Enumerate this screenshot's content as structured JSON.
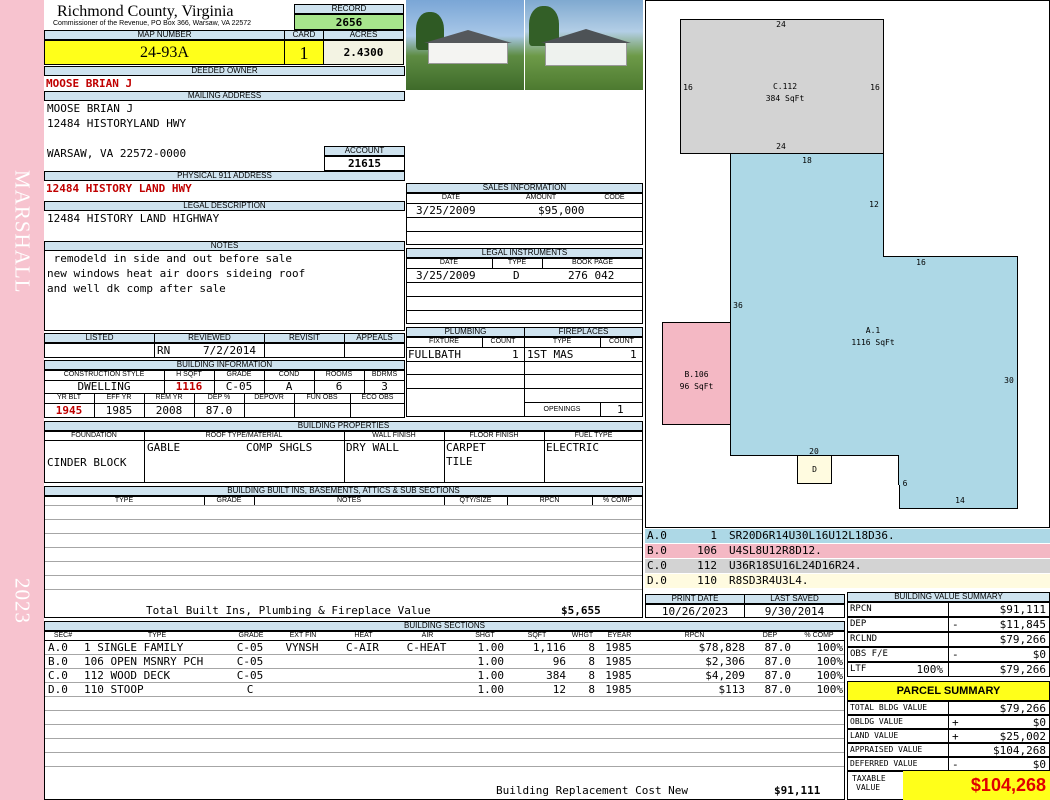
{
  "side": {
    "district": "MARSHALL",
    "year": "2023"
  },
  "header": {
    "county": "Richmond County, Virginia",
    "commissioner": "Commissioner of the Revenue, PO Box 366, Warsaw, VA 22572",
    "record_label": "RECORD",
    "record": "2656",
    "map_label": "MAP NUMBER",
    "map_number": "24-93A",
    "card_label": "CARD",
    "card": "1",
    "acres_label": "ACRES",
    "acres": "2.4300"
  },
  "owner": {
    "deeded_label": "DEEDED OWNER",
    "deeded": "MOOSE BRIAN J",
    "mailing_label": "MAILING ADDRESS",
    "mail_line1": "MOOSE BRIAN J",
    "mail_line2": "12484 HISTORYLAND HWY",
    "mail_line3": "WARSAW, VA 22572-0000",
    "account_label": "ACCOUNT",
    "account": "21615",
    "physical_label": "PHYSICAL 911 ADDRESS",
    "physical": "12484 HISTORY LAND HWY",
    "legal_label": "LEGAL DESCRIPTION",
    "legal": "12484 HISTORY LAND HIGHWAY",
    "notes_label": "NOTES",
    "note1": " remodeld in side and out before sale",
    "note2": "new windows heat air doors sideing roof",
    "note3": "and well dk comp after sale"
  },
  "listing": {
    "listed_label": "LISTED",
    "reviewed_label": "REVIEWED",
    "revisit_label": "REVISIT",
    "appeals_label": "APPEALS",
    "reviewer": "RN",
    "reviewed_date": "7/2/2014"
  },
  "building_info": {
    "title": "BUILDING INFORMATION",
    "h1": "CONSTRUCTION STYLE",
    "h2": "H SQFT",
    "h3": "GRADE",
    "h4": "COND",
    "h5": "ROOMS",
    "h6": "BDRMS",
    "style": "DWELLING",
    "hsqft": "1116",
    "grade": "C-05",
    "cond": "A",
    "rooms": "6",
    "bdrms": "3",
    "g1": "YR BLT",
    "g2": "EFF YR",
    "g3": "REM YR",
    "g4": "DEP %",
    "g5": "DEPOVR",
    "g6": "FUN OBS",
    "g7": "ECO OBS",
    "yrblt": "1945",
    "effyr": "1985",
    "remyr": "2008",
    "dep": "87.0"
  },
  "sales": {
    "title": "SALES INFORMATION",
    "date_h": "DATE",
    "amount_h": "AMOUNT",
    "code_h": "CODE",
    "date": "3/25/2009",
    "amount": "$95,000"
  },
  "legal_instruments": {
    "title": "LEGAL INSTRUMENTS",
    "date_h": "DATE",
    "type_h": "TYPE",
    "book_h": "BOOK PAGE",
    "date": "3/25/2009",
    "type": "D",
    "book": "276 042"
  },
  "plumbing": {
    "title": "PLUMBING",
    "fixture_h": "FIXTURE",
    "count_h": "COUNT",
    "fixture": "FULLBATH",
    "count": "1"
  },
  "fireplaces": {
    "title": "FIREPLACES",
    "type_h": "TYPE",
    "count_h": "COUNT",
    "type": "1ST MAS",
    "count": "1",
    "openings_label": "OPENINGS",
    "openings": "1"
  },
  "properties": {
    "title": "BUILDING PROPERTIES",
    "foundation_h": "FOUNDATION",
    "roof_h": "ROOF TYPE/MATERIAL",
    "wall_h": "WALL FINISH",
    "floor_h": "FLOOR FINISH",
    "fuel_h": "FUEL TYPE",
    "foundation": "CINDER BLOCK",
    "roof_type": "GABLE",
    "roof_material": "COMP SHGLS",
    "wall": "DRY WALL",
    "floor1": "CARPET",
    "floor2": "TILE",
    "fuel": "ELECTRIC"
  },
  "builtins": {
    "title": "BUILDING BUILT INS, BASEMENTS, ATTICS & SUB SECTIONS",
    "type_h": "TYPE",
    "grade_h": "GRADE",
    "notes_h": "NOTES",
    "qty_h": "QTY/SIZE",
    "rpcn_h": "RPCN",
    "comp_h": "% COMP",
    "total_label": "Total Built Ins, Plumbing & Fireplace Value",
    "total": "$5,655"
  },
  "sketch": {
    "labels": {
      "c_name": "C.112",
      "c_area": "384 SqFt",
      "a_name": "A.1",
      "a_area": "1116 SqFt",
      "b_name": "B.106",
      "b_area": "96 SqFt",
      "d_name": "D"
    },
    "dims": [
      "24",
      "16",
      "16",
      "24",
      "18",
      "12",
      "16",
      "36",
      "30",
      "20",
      "6",
      "14"
    ],
    "colors": {
      "c": "#d3d3d3",
      "a": "#add8e6",
      "b": "#f4b8c4",
      "d": "#fffbe0"
    }
  },
  "sketch_codes": [
    {
      "sec": "A.0",
      "num": "1",
      "code": "SR20D6R14U30L16U12L18D36.",
      "color": "#add8e6"
    },
    {
      "sec": "B.0",
      "num": "106",
      "code": "U4SL8U12R8D12.",
      "color": "#f4b8c4"
    },
    {
      "sec": "C.0",
      "num": "112",
      "code": "U36R18SU16L24D16R24.",
      "color": "#d3d3d3"
    },
    {
      "sec": "D.0",
      "num": "110",
      "code": "R8SD3R4U3L4.",
      "color": "#fffbe0"
    }
  ],
  "print": {
    "print_label": "PRINT DATE",
    "saved_label": "LAST SAVED",
    "print_date": "10/26/2023",
    "last_saved": "9/30/2014"
  },
  "sections": {
    "title": "BUILDING SECTIONS",
    "headers": [
      "SEC#",
      "TYPE",
      "GRADE",
      "EXT FIN",
      "HEAT",
      "AIR",
      "SHGT",
      "SQFT",
      "WHGT",
      "EYEAR",
      "RPCN",
      "DEP",
      "% COMP"
    ],
    "rows": [
      [
        "A.0",
        "1 SINGLE FAMILY",
        "C-05",
        "VYNSH",
        "C-AIR",
        "C-HEAT",
        "1.00",
        "1,116",
        "8",
        "1985",
        "$78,828",
        "87.0",
        "100%"
      ],
      [
        "B.0",
        "106 OPEN MSNRY PCH",
        "C-05",
        "",
        "",
        "",
        "1.00",
        "96",
        "8",
        "1985",
        "$2,306",
        "87.0",
        "100%"
      ],
      [
        "C.0",
        "112 WOOD DECK",
        "C-05",
        "",
        "",
        "",
        "1.00",
        "384",
        "8",
        "1985",
        "$4,209",
        "87.0",
        "100%"
      ],
      [
        "D.0",
        "110 STOOP",
        "C",
        "",
        "",
        "",
        "1.00",
        "12",
        "8",
        "1985",
        "$113",
        "87.0",
        "100%"
      ]
    ],
    "replacement_label": "Building Replacement Cost New",
    "replacement": "$91,111"
  },
  "value_summary": {
    "title": "BUILDING VALUE SUMMARY",
    "rows": [
      {
        "label": "RPCN",
        "sign": "",
        "value": "$91,111"
      },
      {
        "label": "DEP",
        "sign": "-",
        "value": "$11,845"
      },
      {
        "label": "RCLND",
        "sign": "",
        "value": "$79,266"
      },
      {
        "label": "OBS F/E",
        "sign": "-",
        "value": "$0"
      },
      {
        "label": "LTF",
        "sign": "100%",
        "value": "$79,266"
      }
    ]
  },
  "parcel": {
    "title": "PARCEL SUMMARY",
    "rows": [
      {
        "label": "TOTAL BLDG VALUE",
        "sign": "",
        "value": "$79,266"
      },
      {
        "label": "OBLDG VALUE",
        "sign": "+",
        "value": "$0"
      },
      {
        "label": "LAND VALUE",
        "sign": "+",
        "value": "$25,002"
      },
      {
        "label": "APPRAISED VALUE",
        "sign": "",
        "value": "$104,268"
      },
      {
        "label": "DEFERRED VALUE",
        "sign": "-",
        "value": "$0"
      }
    ],
    "taxable_label1": "TAXABLE",
    "taxable_label2": "VALUE",
    "taxable": "$104,268"
  }
}
